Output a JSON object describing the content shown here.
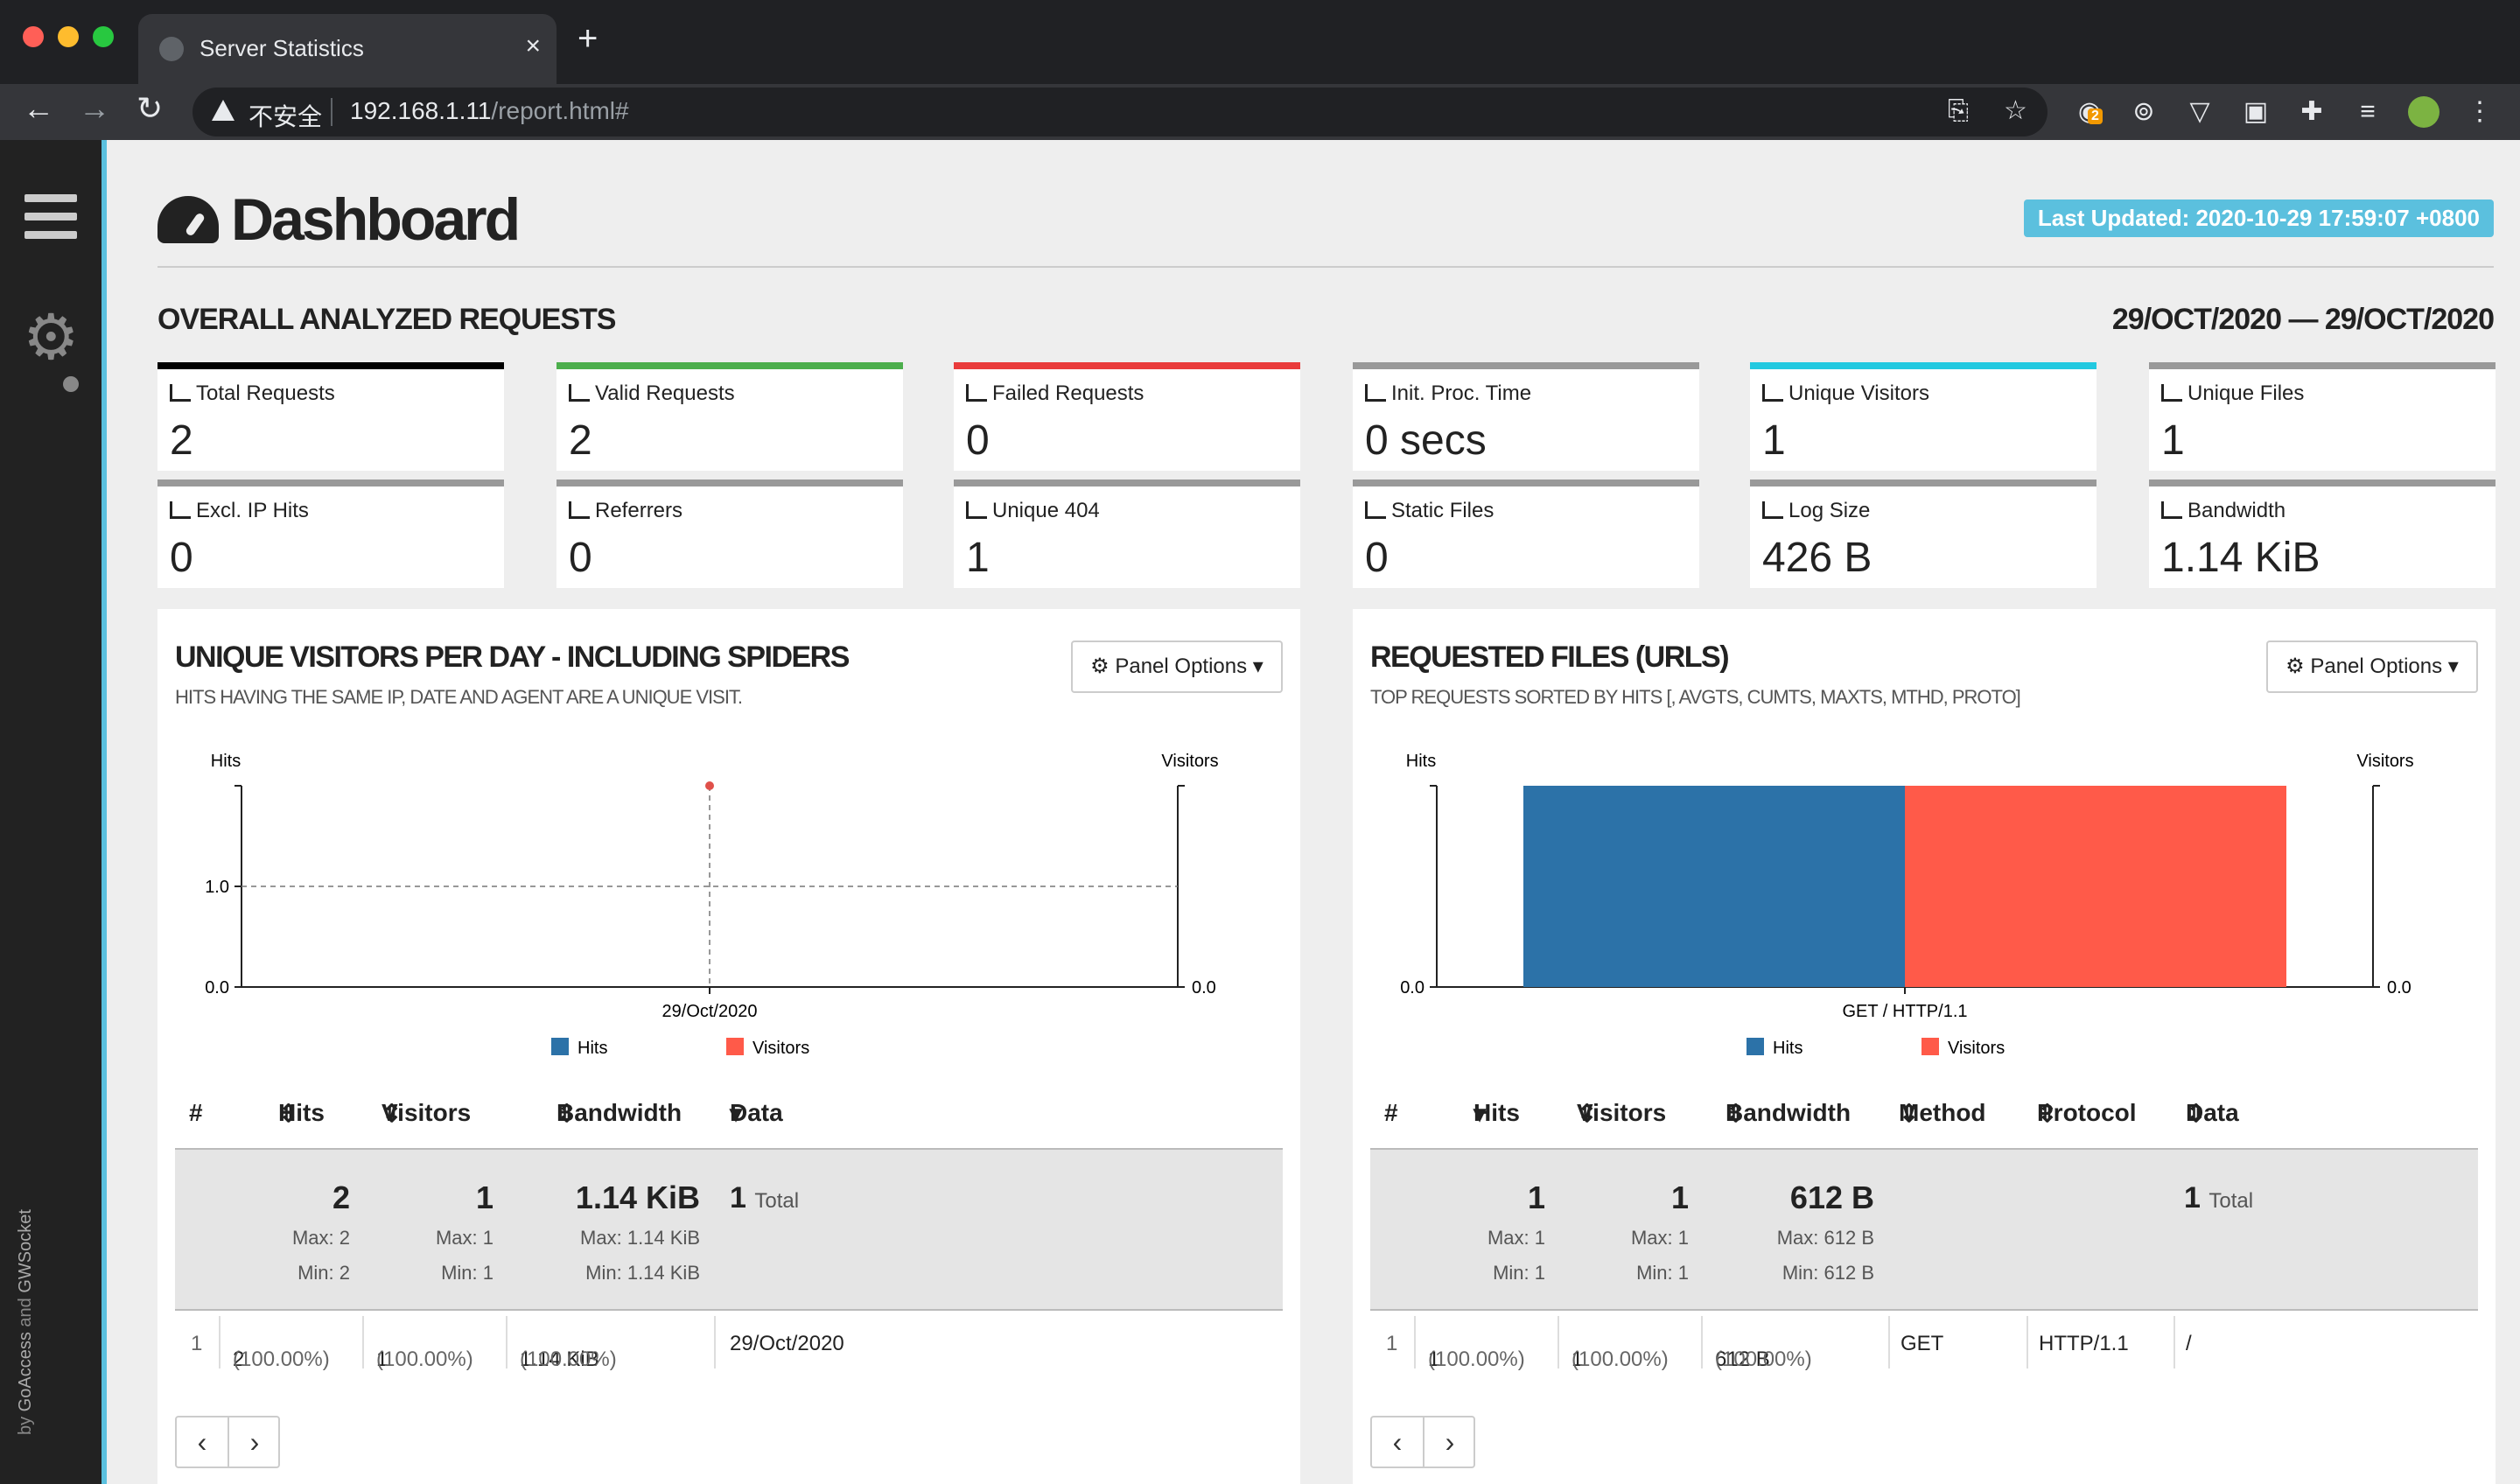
{
  "browser": {
    "tab_title": "Server Statistics",
    "close_glyph": "×",
    "new_tab_glyph": "+",
    "security_label": "不安全",
    "url_host": "192.168.1.11",
    "url_path": "/report.html#",
    "extension_badge": "2"
  },
  "sidebar": {
    "byline_prefix": "by ",
    "byline_goaccess": "GoAccess",
    "byline_and": " and ",
    "byline_gwsocket": "GWSocket"
  },
  "header": {
    "title": "Dashboard",
    "last_updated": "Last Updated: 2020-10-29 17:59:07 +0800"
  },
  "overall": {
    "heading": "OVERALL ANALYZED REQUESTS",
    "date_range": "29/OCT/2020 — 29/OCT/2020",
    "cards": [
      {
        "label": "Total Requests",
        "value": "2",
        "color": "#000000"
      },
      {
        "label": "Valid Requests",
        "value": "2",
        "color": "#4cae4c"
      },
      {
        "label": "Failed Requests",
        "value": "0",
        "color": "#e93b3b"
      },
      {
        "label": "Init. Proc. Time",
        "value": "0 secs",
        "color": "#999999"
      },
      {
        "label": "Unique Visitors",
        "value": "1",
        "color": "#22c9e0"
      },
      {
        "label": "Unique Files",
        "value": "1",
        "color": "#999999"
      },
      {
        "label": "Excl. IP Hits",
        "value": "0",
        "color": "#999999"
      },
      {
        "label": "Referrers",
        "value": "0",
        "color": "#999999"
      },
      {
        "label": "Unique 404",
        "value": "1",
        "color": "#999999"
      },
      {
        "label": "Static Files",
        "value": "0",
        "color": "#999999"
      },
      {
        "label": "Log Size",
        "value": "426 B",
        "color": "#999999"
      },
      {
        "label": "Bandwidth",
        "value": "1.14 KiB",
        "color": "#999999"
      }
    ]
  },
  "visitors_panel": {
    "title": "UNIQUE VISITORS PER DAY - INCLUDING SPIDERS",
    "subtitle": "HITS HAVING THE SAME IP, DATE AND AGENT ARE A UNIQUE VISIT.",
    "options_label": "Panel Options",
    "columns": [
      "#",
      "Hits",
      "Visitors",
      "Bandwidth",
      "Data"
    ],
    "summary": {
      "hits": "2",
      "hits_max": "Max: 2",
      "hits_min": "Min: 2",
      "visitors": "1",
      "visitors_max": "Max: 1",
      "visitors_min": "Min: 1",
      "bandwidth": "1.14 KiB",
      "bandwidth_max": "Max: 1.14 KiB",
      "bandwidth_min": "Min: 1.14 KiB",
      "data_count": "1",
      "data_label": "Total"
    },
    "row": {
      "index": "1",
      "hits": "2",
      "hits_pct": "(100.00%)",
      "visitors": "1",
      "visitors_pct": "(100.00%)",
      "bandwidth": "1.14 KiB",
      "bandwidth_pct": "(100.00%)",
      "data": "29/Oct/2020"
    }
  },
  "files_panel": {
    "title": "REQUESTED FILES (URLS)",
    "subtitle": "TOP REQUESTS SORTED BY HITS [, AVGTS, CUMTS, MAXTS, MTHD, PROTO]",
    "options_label": "Panel Options",
    "columns": [
      "#",
      "Hits",
      "Visitors",
      "Bandwidth",
      "Method",
      "Protocol",
      "Data"
    ],
    "summary": {
      "hits": "1",
      "hits_max": "Max: 1",
      "hits_min": "Min: 1",
      "visitors": "1",
      "visitors_max": "Max: 1",
      "visitors_min": "Min: 1",
      "bandwidth": "612 B",
      "bandwidth_max": "Max: 612 B",
      "bandwidth_min": "Min: 612 B",
      "data_count": "1",
      "data_label": "Total"
    },
    "row": {
      "index": "1",
      "hits": "1",
      "hits_pct": "(100.00%)",
      "visitors": "1",
      "visitors_pct": "(100.00%)",
      "bandwidth": "612 B",
      "bandwidth_pct": "(100.00%)",
      "method": "GET",
      "protocol": "HTTP/1.1",
      "data": "/"
    }
  },
  "chart_data": [
    {
      "type": "line",
      "categories": [
        "29/Oct/2020"
      ],
      "series": [
        {
          "name": "Hits",
          "values": [
            2
          ],
          "color": "#2c72a8"
        },
        {
          "name": "Visitors",
          "values": [
            1
          ],
          "color": "#ff5a49"
        }
      ],
      "ylabel": "Hits",
      "y2label": "Visitors",
      "yticks": [
        "0.0",
        "1.0"
      ],
      "y2ticks": [
        "0.0"
      ],
      "legend": "bottom"
    },
    {
      "type": "bar",
      "categories": [
        "GET / HTTP/1.1"
      ],
      "series": [
        {
          "name": "Hits",
          "values": [
            1
          ],
          "color": "#2c72a8"
        },
        {
          "name": "Visitors",
          "values": [
            1
          ],
          "color": "#ff5a49"
        }
      ],
      "ylabel": "Hits",
      "y2label": "Visitors",
      "yticks": [
        "0.0"
      ],
      "y2ticks": [
        "0.0"
      ],
      "legend": "bottom"
    }
  ]
}
